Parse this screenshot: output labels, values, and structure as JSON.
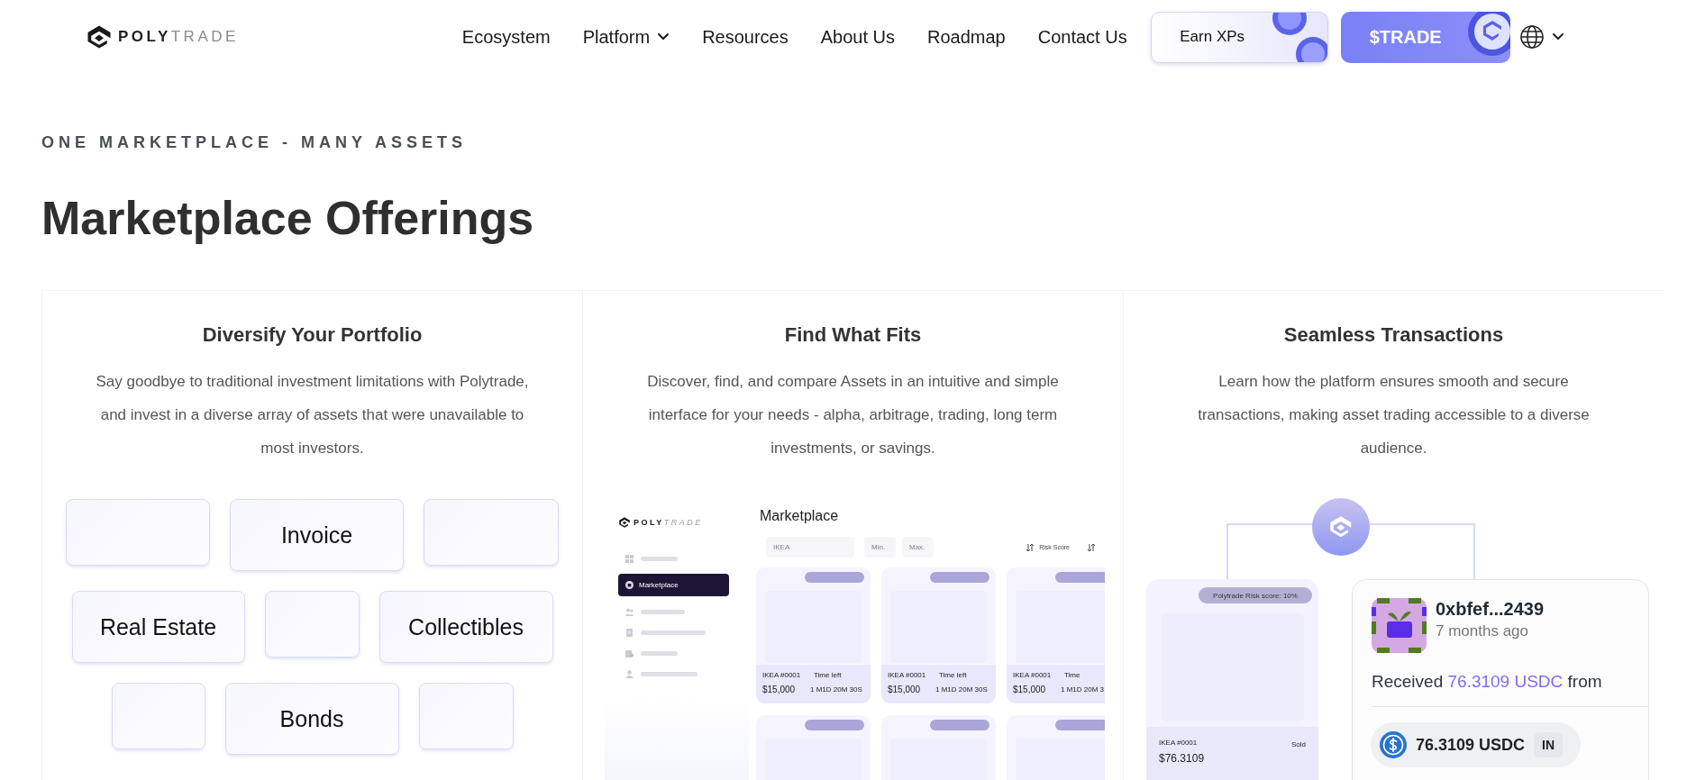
{
  "header": {
    "logo": {
      "bold": "POLY",
      "light": "TRADE"
    },
    "nav": [
      {
        "label": "Ecosystem",
        "dropdown": false
      },
      {
        "label": "Platform",
        "dropdown": true
      },
      {
        "label": "Resources",
        "dropdown": false
      },
      {
        "label": "About Us",
        "dropdown": false
      },
      {
        "label": "Roadmap",
        "dropdown": false
      },
      {
        "label": "Contact Us",
        "dropdown": false
      }
    ],
    "earn_button": "Earn XPs",
    "trade_button": "$TRADE"
  },
  "eyebrow": "ONE MARKETPLACE - MANY ASSETS",
  "title": "Marketplace Offerings",
  "offerings": [
    {
      "kind": "asset_tiles",
      "heading": "Diversify Your Portfolio",
      "text": "Say goodbye to traditional investment limitations with Polytrade, and invest in a diverse array of assets that were unavailable to most investors.",
      "tile_rows": [
        {
          "tiles": [
            {
              "kind": "blank"
            },
            {
              "kind": "label",
              "label": "Invoice"
            },
            {
              "kind": "blank"
            }
          ]
        },
        {
          "tiles": [
            {
              "kind": "label",
              "label": "Real Estate"
            },
            {
              "kind": "blank"
            },
            {
              "kind": "label",
              "label": "Collectibles"
            }
          ]
        },
        {
          "tiles": [
            {
              "kind": "blank"
            },
            {
              "kind": "label",
              "label": "Bonds"
            },
            {
              "kind": "blank"
            }
          ]
        }
      ]
    },
    {
      "kind": "marketplace_mockup",
      "heading": "Find What Fits",
      "text": "Discover, find, and compare Assets in an intuitive and simple interface for your needs - alpha, arbitrage, trading, long term investments, or savings.",
      "mockup": {
        "logo": {
          "bold": "POLY",
          "light": "TRADE"
        },
        "title": "Marketplace",
        "sidebar": [
          {
            "selected": false
          },
          {
            "label": "Marketplace",
            "selected": true
          },
          {
            "selected": false
          },
          {
            "selected": false
          },
          {
            "selected": false
          },
          {
            "selected": false
          }
        ],
        "search_placeholder": "IKEA",
        "min_placeholder": "Min.",
        "max_placeholder": "Max.",
        "sort_label": "Risk Score",
        "cards": [
          {
            "kind": "listing",
            "name": "IKEA #0001",
            "price": "$15,000",
            "time_label": "Time left",
            "time": "1 M1D 20M 30S"
          },
          {
            "kind": "listing",
            "name": "IKEA #0001",
            "price": "$15,000",
            "time_label": "Time left",
            "time": "1 M1D 20M 30S"
          },
          {
            "kind": "listing",
            "name": "IKEA #0001",
            "price": "$15,000",
            "time_label": "Time",
            "time": "1 M1D 20M 3"
          },
          {
            "kind": "placeholder"
          },
          {
            "kind": "placeholder"
          },
          {
            "kind": "placeholder"
          }
        ]
      }
    },
    {
      "kind": "transaction",
      "heading": "Seamless Transactions",
      "text": "Learn how the platform ensures smooth and secure transactions, making asset trading accessible to a diverse audience.",
      "asset_card": {
        "pill": "Polytrade Risk score: 10%",
        "name": "IKEA #0001",
        "price": "$76.3109",
        "status": "Sold"
      },
      "activity": {
        "address": "0xbfef...2439",
        "time": "7 months ago",
        "prefix": "Received",
        "amount": "76.3109 USDC",
        "suffix": "from",
        "token_amount": "76.3109 USDC",
        "direction": "IN"
      }
    }
  ]
}
